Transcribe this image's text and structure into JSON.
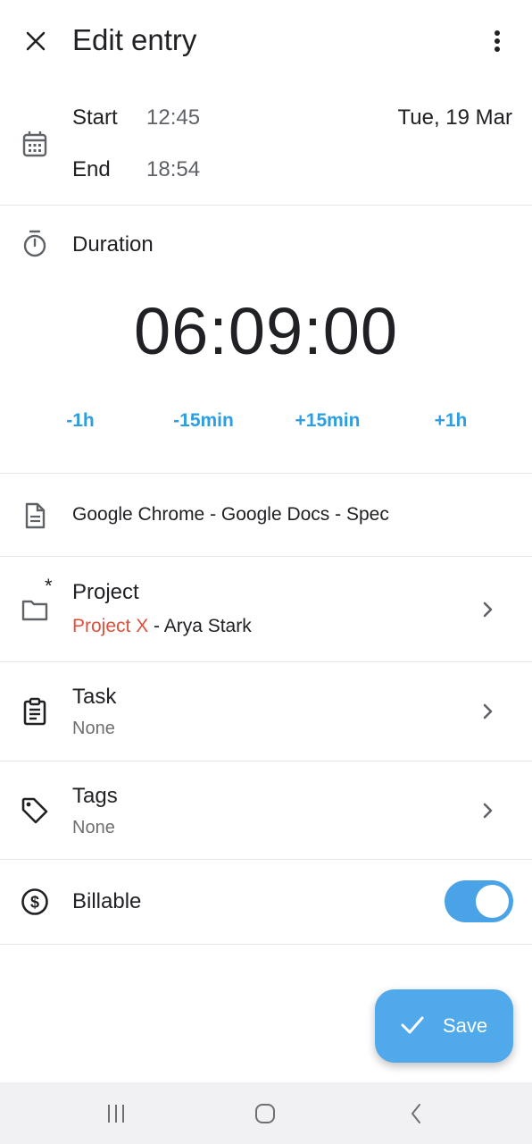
{
  "appbar": {
    "title": "Edit entry",
    "close_icon": "close-icon",
    "more_icon": "more-vert-icon"
  },
  "time": {
    "start_label": "Start",
    "start_value": "12:45",
    "end_label": "End",
    "end_value": "18:54",
    "date": "Tue, 19 Mar",
    "icon": "calendar-icon"
  },
  "duration": {
    "label": "Duration",
    "value": "06:09:00",
    "icon": "stopwatch-icon",
    "adjust": [
      "-1h",
      "-15min",
      "+15min",
      "+1h"
    ]
  },
  "description": {
    "text": "Google Chrome - Google Docs - Spec",
    "icon": "document-icon"
  },
  "project": {
    "label": "Project",
    "required_mark": "*",
    "project_name": "Project X",
    "client": " - Arya Stark",
    "icon": "folder-icon"
  },
  "task": {
    "label": "Task",
    "value": "None",
    "icon": "clipboard-icon"
  },
  "tags": {
    "label": "Tags",
    "value": "None",
    "icon": "tag-icon"
  },
  "billable": {
    "label": "Billable",
    "enabled": true,
    "icon": "dollar-icon"
  },
  "fab": {
    "label": "Save",
    "icon": "check-icon"
  },
  "colors": {
    "accent": "#2f9ee0",
    "fab": "#4fa9ea",
    "project": "#e0503a"
  }
}
